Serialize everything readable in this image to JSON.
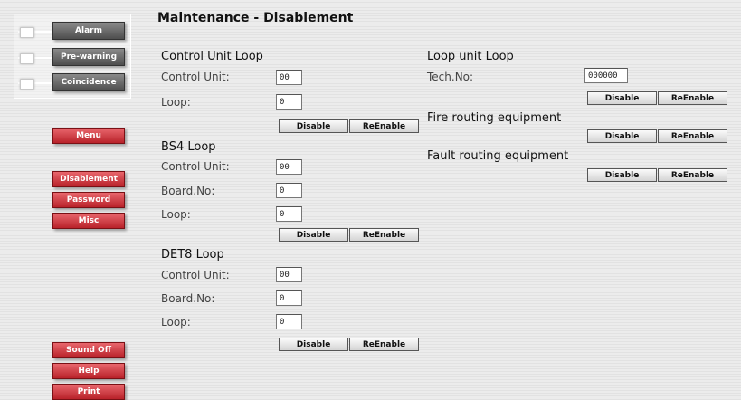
{
  "lamps": {
    "alarm": "Alarm",
    "prewarning": "Pre-warning",
    "coincidence": "Coincidence"
  },
  "nav": {
    "menu": "Menu",
    "disablement": "Disablement",
    "password": "Password",
    "misc": "Misc",
    "sound_off": "Sound Off",
    "help": "Help",
    "print": "Print"
  },
  "page_title": "Maintenance - Disablement",
  "labels": {
    "control_unit": "Control Unit:",
    "board_no": "Board.No:",
    "loop": "Loop:",
    "tech_no": "Tech.No:"
  },
  "buttons": {
    "disable": "Disable",
    "reenable": "ReEnable"
  },
  "control_unit_loop": {
    "title": "Control Unit Loop",
    "control_unit": "00",
    "loop": "0"
  },
  "bs4_loop": {
    "title": "BS4 Loop",
    "control_unit": "00",
    "board_no": "0",
    "loop": "0"
  },
  "det8_loop": {
    "title": "DET8 Loop",
    "control_unit": "00",
    "board_no": "0",
    "loop": "0"
  },
  "loop_unit_loop": {
    "title": "Loop unit Loop",
    "tech_no": "000000"
  },
  "fire_routing": {
    "title": "Fire routing equipment"
  },
  "fault_routing": {
    "title": "Fault routing equipment"
  }
}
